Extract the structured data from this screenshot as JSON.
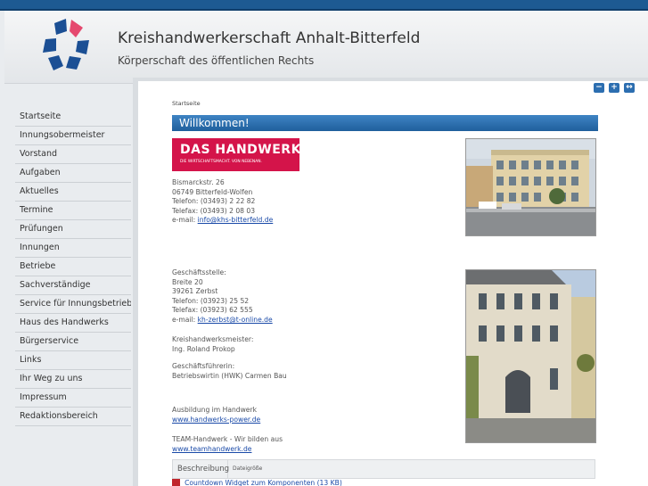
{
  "header": {
    "title": "Kreishandwerkerschaft Anhalt-Bitterfeld",
    "subtitle": "Körperschaft des öffentlichen Rechts"
  },
  "sidebar": {
    "items": [
      {
        "label": "Startseite"
      },
      {
        "label": "Innungsobermeister"
      },
      {
        "label": "Vorstand"
      },
      {
        "label": "Aufgaben"
      },
      {
        "label": "Aktuelles"
      },
      {
        "label": "Termine"
      },
      {
        "label": "Prüfungen"
      },
      {
        "label": "Innungen"
      },
      {
        "label": "Betriebe"
      },
      {
        "label": "Sachverständige"
      },
      {
        "label": "Service für Innungsbetriebe"
      },
      {
        "label": "Haus des Handwerks"
      },
      {
        "label": "Bürgerservice"
      },
      {
        "label": "Links"
      },
      {
        "label": "Ihr Weg zu uns"
      },
      {
        "label": "Impressum"
      },
      {
        "label": "Redaktionsbereich"
      }
    ]
  },
  "toolbar": {
    "minus_label": "−",
    "plus_label": "+",
    "fullscreen_label": "↔"
  },
  "main": {
    "breadcrumb": "Startseite",
    "heading": "Willkommen!",
    "hw_logo": {
      "line1": "DAS HANDWERK",
      "line2": "DIE WIRTSCHAFTSMACHT. VON NEBENAN."
    },
    "office1": {
      "street": "Bismarckstr. 26",
      "city": "06749 Bitterfeld-Wolfen",
      "phone": "Telefon: (03493) 2 22 82",
      "fax": "Telefax: (03493) 2 08 03",
      "email_prefix": "e-mail: ",
      "email": "info@khs-bitterfeld.de"
    },
    "office2": {
      "label": "Geschäftsstelle:",
      "street": "Breite 20",
      "city": "39261 Zerbst",
      "phone": "Telefon: (03923) 25 52",
      "fax": "Telefax: (03923) 62 555",
      "email_prefix": "e-mail: ",
      "email": "kh-zerbst@t-online.de"
    },
    "master": {
      "label": "Kreishandwerksmeister:",
      "name": "Ing. Roland Prokop"
    },
    "manager": {
      "label": "Geschäftsführerin:",
      "name": "Betriebswirtin (HWK) Carmen Bau"
    },
    "training": {
      "label": "Ausbildung im Handwerk",
      "link": "www.handwerks-power.de"
    },
    "team": {
      "label": "TEAM-Handwerk - Wir bilden aus",
      "link": "www.teamhandwerk.de"
    },
    "table": {
      "col_description": "Beschreibung",
      "col_size": "Dateigröße",
      "row_text": "Countdown Widget zum Komponenten (13 KB)"
    }
  },
  "colors": {
    "topbar": "#1d5a92",
    "heading_bar": "#2d72b4",
    "brand_red": "#d4144a",
    "link": "#1a4aa8"
  }
}
